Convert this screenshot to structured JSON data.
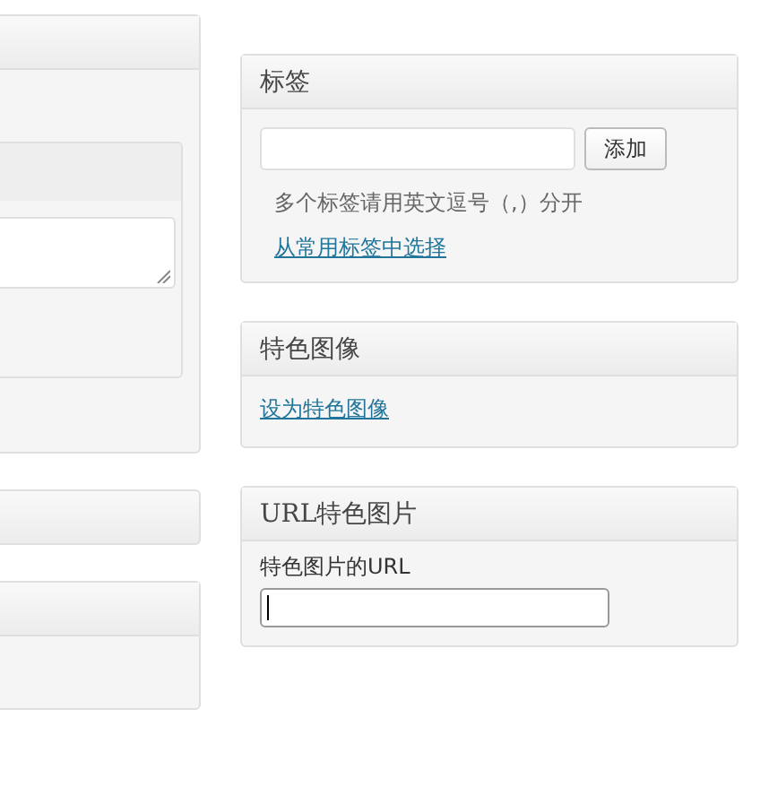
{
  "tags_box": {
    "title": "标签",
    "button": "添加",
    "hint": "多个标签请用英文逗号（,）分开",
    "link": "从常用标签中选择"
  },
  "featured_image_box": {
    "title": "特色图像",
    "link": "设为特色图像"
  },
  "url_image_box": {
    "title": "URL特色图片",
    "label": "特色图片的URL",
    "input_focused": true
  }
}
